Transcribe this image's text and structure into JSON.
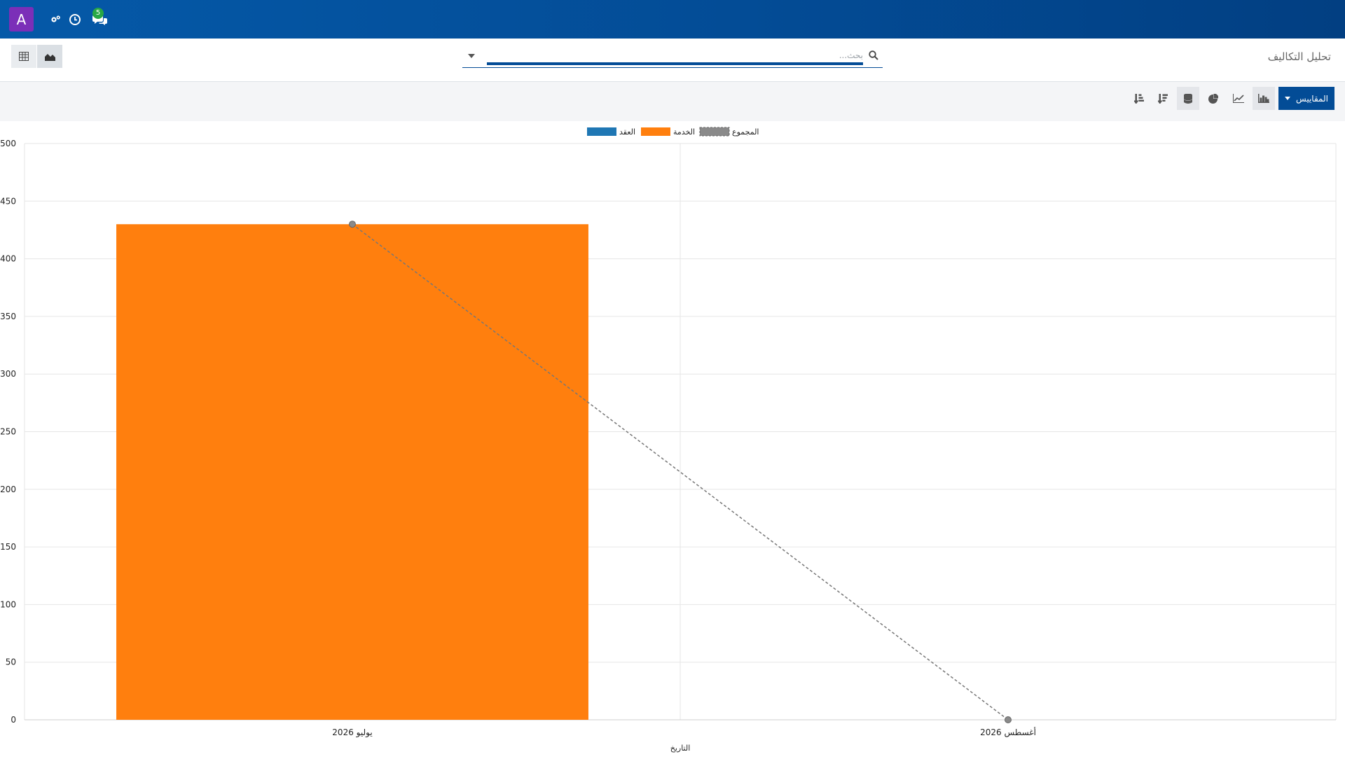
{
  "navbar": {
    "app_initial": "A",
    "messages_count": "5",
    "icons": [
      "apps-gears-icon",
      "activity-clock-icon",
      "discuss-chat-icon"
    ]
  },
  "control_panel": {
    "title": "تحليل التكاليف",
    "search_placeholder": "بحث...",
    "view_icons": [
      "pivot-table-icon",
      "graph-area-icon"
    ]
  },
  "toolbar": {
    "measures_label": "المقاييس",
    "tools": [
      "bar-chart-icon",
      "line-chart-icon",
      "pie-chart-icon",
      "stacked-icon",
      "sort-descending-icon",
      "sort-ascending-icon"
    ]
  },
  "colors": {
    "navbar": "#034c96",
    "accent": "#034c96",
    "avatar": "#7b2fb8",
    "badge": "#28a745",
    "series_contract": "#1f77b4",
    "series_service": "#ff7f0e",
    "series_total": "#999999"
  },
  "chart_data": {
    "type": "bar",
    "xlabel": "التاريخ",
    "ylabel": "",
    "categories": [
      "يوليو 2026",
      "أغسطس 2026"
    ],
    "ylim": [
      0,
      500
    ],
    "yticks": [
      0,
      50,
      100,
      150,
      200,
      250,
      300,
      350,
      400,
      450,
      500
    ],
    "legend": [
      "العقد",
      "الخدمة",
      "المجموع"
    ],
    "legend_position": "top-center",
    "grid": true,
    "series": [
      {
        "name": "العقد",
        "type": "bar",
        "color": "#1f77b4",
        "values": [
          0,
          0
        ]
      },
      {
        "name": "الخدمة",
        "type": "bar",
        "color": "#ff7f0e",
        "values": [
          430,
          0
        ]
      },
      {
        "name": "المجموع",
        "type": "line",
        "style": "dashed",
        "color": "#777777",
        "values": [
          430,
          0
        ]
      }
    ]
  }
}
